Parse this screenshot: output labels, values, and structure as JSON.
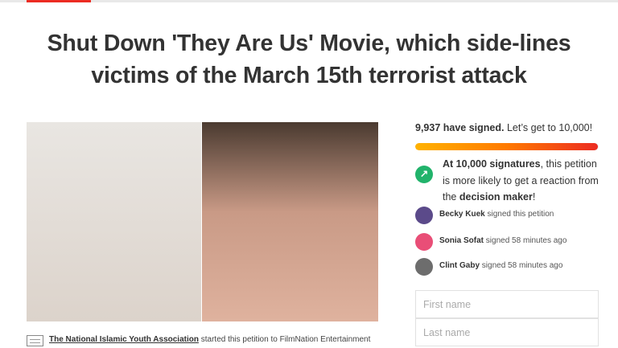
{
  "header": {
    "accent_color": "#ec2c22"
  },
  "petition": {
    "title": "Shut Down 'They Are Us' Movie, which side-lines victims of the March 15th terrorist attack"
  },
  "signatures": {
    "count_text": "9,937 have signed.",
    "goal_text": "Let’s get to 10,000!",
    "progress_fraction": 0.9937
  },
  "reaction": {
    "icon": "trending-up-icon",
    "part1": "At 10,000 signatures",
    "part2": ", this petition is more likely to get a reaction from the ",
    "part3": "decision maker",
    "part4": "!"
  },
  "recent_signers": [
    {
      "name": "Becky Kuek",
      "action": "signed this petition",
      "avatar_color": "#5b4a8a"
    },
    {
      "name": "Sonia Sofat",
      "action": "signed 58 minutes ago",
      "avatar_color": "#e94e77"
    },
    {
      "name": "Clint Gaby",
      "action": "signed 58 minutes ago",
      "avatar_color": "#6d6d6d"
    }
  ],
  "form": {
    "first_name_placeholder": "First name",
    "last_name_placeholder": "Last name"
  },
  "starter": {
    "organization": "The National Islamic Youth Association",
    "text": " started this petition to FilmNation Entertainment"
  }
}
